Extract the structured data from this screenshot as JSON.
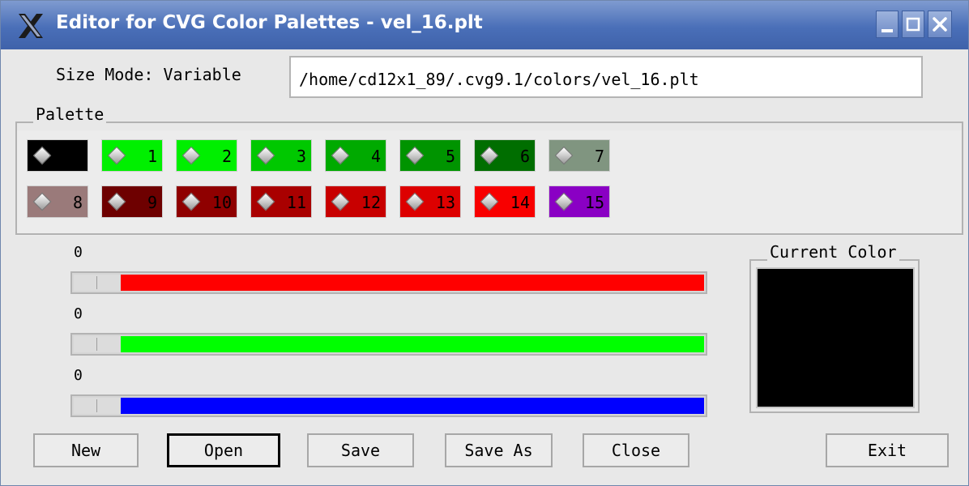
{
  "window": {
    "title": "Editor for CVG Color Palettes - vel_16.plt",
    "app_icon": "x-icon"
  },
  "header": {
    "size_mode": "Size Mode: Variable",
    "path": "/home/cd12x1_89/.cvg9.1/colors/vel_16.plt"
  },
  "palette": {
    "title": "Palette",
    "colors": [
      {
        "index": "",
        "color": "#000000"
      },
      {
        "index": "1",
        "color": "#00f000"
      },
      {
        "index": "2",
        "color": "#00ef00"
      },
      {
        "index": "3",
        "color": "#00c800"
      },
      {
        "index": "4",
        "color": "#00aa00"
      },
      {
        "index": "5",
        "color": "#009400"
      },
      {
        "index": "6",
        "color": "#006e00"
      },
      {
        "index": "7",
        "color": "#809580"
      },
      {
        "index": "8",
        "color": "#9a7a7a"
      },
      {
        "index": "9",
        "color": "#6e0000"
      },
      {
        "index": "10",
        "color": "#8f0000"
      },
      {
        "index": "11",
        "color": "#a90000"
      },
      {
        "index": "12",
        "color": "#c80000"
      },
      {
        "index": "13",
        "color": "#dd0000"
      },
      {
        "index": "14",
        "color": "#f80000"
      },
      {
        "index": "15",
        "color": "#8a00c4"
      }
    ]
  },
  "sliders": [
    {
      "value": "0",
      "color": "#ff0000"
    },
    {
      "value": "0",
      "color": "#00ff00"
    },
    {
      "value": "0",
      "color": "#0000ff"
    }
  ],
  "current_color": {
    "title": "Current Color",
    "color": "#000000"
  },
  "buttons": {
    "new": "New",
    "open": "Open",
    "save": "Save",
    "save_as": "Save As",
    "close": "Close",
    "exit": "Exit"
  }
}
